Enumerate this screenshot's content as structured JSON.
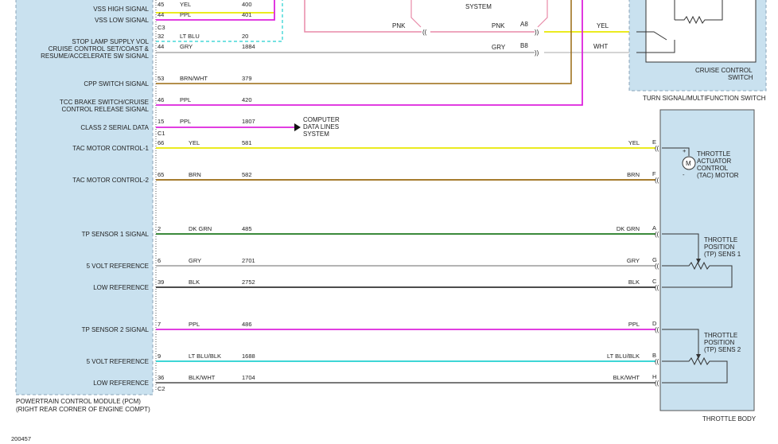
{
  "diagram_id": "200457",
  "pcm": {
    "title_line1": "POWERTRAIN CONTROL MODULE (PCM)",
    "title_line2": "(RIGHT REAR CORNER OF ENGINE COMPT)",
    "connector_c1": "C1",
    "connector_c2": "C2",
    "connector_c3": "C3"
  },
  "top_circuits": [
    {
      "label": "VSS HIGH SIGNAL",
      "pin": "45",
      "color_name": "YEL",
      "circuit": "400",
      "hex": "#e8e800"
    },
    {
      "label": "VSS LOW SIGNAL",
      "pin": "44",
      "color_name": "PPL",
      "circuit": "401",
      "hex": "#dd22dd"
    },
    {
      "label": "STOP LAMP SUPPLY VOL",
      "pin": "32",
      "color_name": "LT BLU",
      "circuit": "20",
      "hex": "#22d0d0"
    }
  ],
  "cruise_signal": {
    "label_line1": "CRUISE CONTROL SET/COAST &",
    "label_line2": "RESUME/ACCELERATE SW SIGNAL",
    "pin": "44",
    "color_name": "GRY",
    "circuit": "1884",
    "right_color": "GRY",
    "right_pin": "B8",
    "switch_color": "WHT",
    "hex": "#999999"
  },
  "pnk_wire": {
    "color_left": "PNK",
    "color_right": "PNK",
    "pin": "A8",
    "switch_color": "YEL",
    "system_text": "SYSTEM"
  },
  "cpp": {
    "label": "CPP SWITCH SIGNAL",
    "pin": "53",
    "color_name": "BRN/WHT",
    "circuit": "379",
    "hex": "#9a6a10"
  },
  "tcc": {
    "label_line1": "TCC BRAKE SWITCH/CRUISE",
    "label_line2": "CONTROL RELEASE SIGNAL",
    "pin": "46",
    "color_name": "PPL",
    "circuit": "420",
    "hex": "#dd22dd"
  },
  "class2": {
    "label": "CLASS 2 SERIAL DATA",
    "pin": "15",
    "color_name": "PPL",
    "circuit": "1807",
    "dest_line1": "COMPUTER",
    "dest_line2": "DATA LINES",
    "dest_line3": "SYSTEM"
  },
  "switch_box": {
    "title_line1": "CRUISE CONTROL",
    "title_line2": "SWITCH",
    "outer_title": "TURN SIGNAL/MULTIFUNCTION SWITCH"
  },
  "throttle_body": {
    "title": "THROTTLE BODY",
    "motor_line1": "THROTTLE",
    "motor_line2": "ACTUATOR",
    "motor_line3": "CONTROL",
    "motor_line4": "(TAC) MOTOR",
    "motor_symbol": "M",
    "tp1_line1": "THROTTLE",
    "tp1_line2": "POSITION",
    "tp1_line3": "(TP) SENS 1",
    "tp2_line1": "THROTTLE",
    "tp2_line2": "POSITION",
    "tp2_line3": "(TP) SENS 2",
    "plus": "+",
    "minus": "-"
  },
  "wires": [
    {
      "label": "TAC MOTOR CONTROL-1",
      "pin": "66",
      "color_name": "YEL",
      "circuit": "581",
      "term": "E",
      "hex": "#e8e800"
    },
    {
      "label": "TAC MOTOR CONTROL-2",
      "pin": "65",
      "color_name": "BRN",
      "circuit": "582",
      "term": "F",
      "hex": "#9a6a10"
    },
    {
      "label": "TP SENSOR 1 SIGNAL",
      "pin": "2",
      "color_name": "DK GRN",
      "circuit": "485",
      "term": "A",
      "hex": "#1f7a1f"
    },
    {
      "label": "5 VOLT REFERENCE",
      "pin": "6",
      "color_name": "GRY",
      "circuit": "2701",
      "term": "G",
      "hex": "#aaaaaa"
    },
    {
      "label": "LOW REFERENCE",
      "pin": "39",
      "color_name": "BLK",
      "circuit": "2752",
      "term": "C",
      "hex": "#333333"
    },
    {
      "label": "TP SENSOR 2 SIGNAL",
      "pin": "7",
      "color_name": "PPL",
      "circuit": "486",
      "term": "D",
      "hex": "#dd22dd"
    },
    {
      "label": "5 VOLT REFERENCE",
      "pin": "9",
      "color_name": "LT BLU/BLK",
      "circuit": "1688",
      "term": "B",
      "hex": "#22d0d0"
    },
    {
      "label": "LOW REFERENCE",
      "pin": "36",
      "color_name": "BLK/WHT",
      "circuit": "1704",
      "term": "H",
      "hex": "#666666"
    }
  ]
}
